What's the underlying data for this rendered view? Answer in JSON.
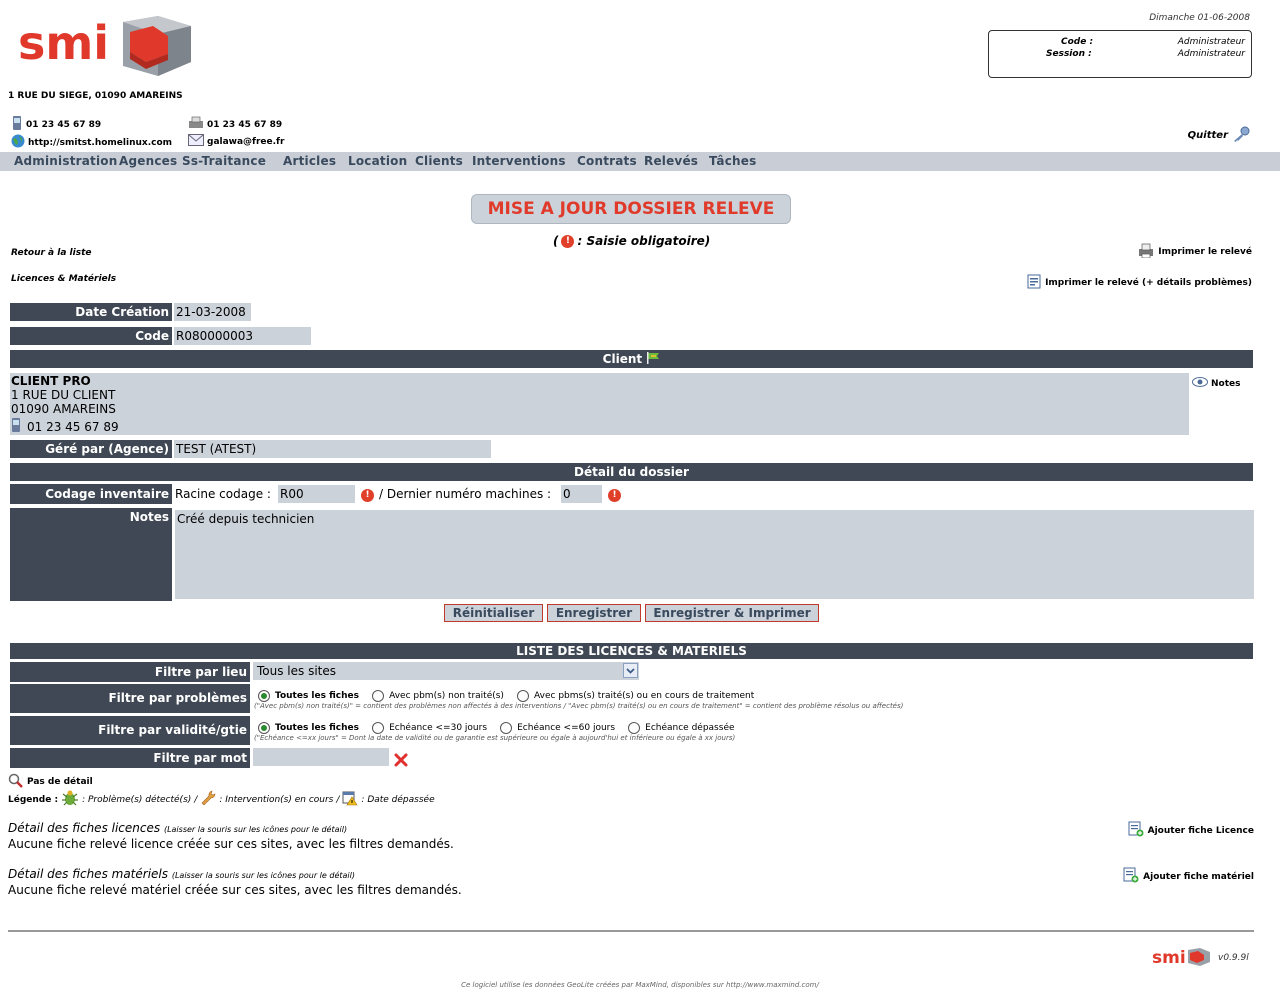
{
  "header": {
    "logo_text": "smi",
    "address": "1 RUE DU SIEGE, 01090 AMAREINS",
    "phone": "01 23 45 67 89",
    "fax": "01 23 45 67 89",
    "website": "http://smitst.homelinux.com",
    "email": "galawa@free.fr",
    "date": "Dimanche 01-06-2008",
    "code_label": "Code :",
    "code_value": "Administrateur",
    "session_label": "Session :",
    "session_value": "Administrateur",
    "quit_label": "Quitter"
  },
  "menu": [
    "Administration",
    "Agences",
    "Ss-Traitance",
    "Articles",
    "Location",
    "Clients",
    "Interventions",
    "Contrats",
    "Relevés",
    "Tâches"
  ],
  "page": {
    "title": "MISE A JOUR DOSSIER RELEVE",
    "mandatory_open": "(",
    "mandatory_text": ": Saisie obligatoire)",
    "req_mark": "!",
    "back_link": "Retour à la liste",
    "licences_link": "Licences & Matériels",
    "print_link": "Imprimer le relevé",
    "print_details_link": "Imprimer le relevé (+ détails problèmes)"
  },
  "form": {
    "date_creation_label": "Date Création",
    "date_creation_value": "21-03-2008",
    "code_label": "Code",
    "code_value": "R080000003",
    "client_header": "Client",
    "client_name": "CLIENT PRO",
    "client_addr1": "1 RUE DU CLIENT",
    "client_addr2": "01090 AMAREINS",
    "client_phone": "01 23 45 67 89",
    "notes_link": "Notes",
    "gere_label": "Géré par (Agence)",
    "gere_value": "TEST (ATEST)",
    "detail_header": "Détail du dossier",
    "codage_label": "Codage inventaire",
    "racine_label": "Racine codage :",
    "racine_value": "R00",
    "dernier_label": "/ Dernier numéro machines :",
    "dernier_value": "0",
    "notes_label": "Notes",
    "notes_value": "Créé depuis technicien"
  },
  "buttons": {
    "reset": "Réinitialiser",
    "save": "Enregistrer",
    "save_print": "Enregistrer & Imprimer"
  },
  "list": {
    "header": "LISTE DES LICENCES & MATERIELS",
    "filter_lieu_label": "Filtre par lieu",
    "filter_lieu_value": "Tous les sites",
    "filter_pb_label": "Filtre par problèmes",
    "filter_pb_options": [
      "Toutes les fiches",
      "Avec pbm(s) non traité(s)",
      "Avec pbms(s) traité(s) ou en cours de traitement"
    ],
    "filter_pb_hint": "(\"Avec pbm(s) non traité(s)\" = contient des problèmes non affectés à des interventions / \"Avec pbm(s) traité(s) ou en cours de traitement\" = contient des problème résolus ou affectés)",
    "filter_val_label": "Filtre par validité/gtie",
    "filter_val_options": [
      "Toutes les fiches",
      "Echéance <=30 jours",
      "Echéance <=60 jours",
      "Echéance dépassée"
    ],
    "filter_val_hint": "(\"Echéance <=xx jours\" = Dont la date de validité ou de garantie est supérieure ou égale à aujourd'hui et inférieure ou égale à xx jours)",
    "filter_mot_label": "Filtre par mot",
    "no_detail": "Pas de détail",
    "legend_label": "Légende :",
    "legend_pb": ": Problème(s) détecté(s)",
    "legend_sep": "/",
    "legend_inter": ": Intervention(s) en cours",
    "legend_date": ": Date dépassée"
  },
  "sections": {
    "licences_title": "Détail des fiches licences",
    "licences_hint": "(Laisser la souris sur les icônes pour le détail)",
    "licences_empty": "Aucune fiche relevé licence créée sur ces sites, avec les filtres demandés.",
    "add_licence": "Ajouter fiche Licence",
    "materiels_title": "Détail des fiches matériels",
    "materiels_hint": "(Laisser la souris sur les icônes pour le détail)",
    "materiels_empty": "Aucune fiche relevé matériel créée sur ces sites, avec les filtres demandés.",
    "add_materiel": "Ajouter fiche matériel"
  },
  "footer": {
    "version": "v0.9.9l",
    "geolite": "Ce logiciel utilise les données GeoLite créées par MaxMind, disponibles sur http://www.maxmind.com/"
  }
}
